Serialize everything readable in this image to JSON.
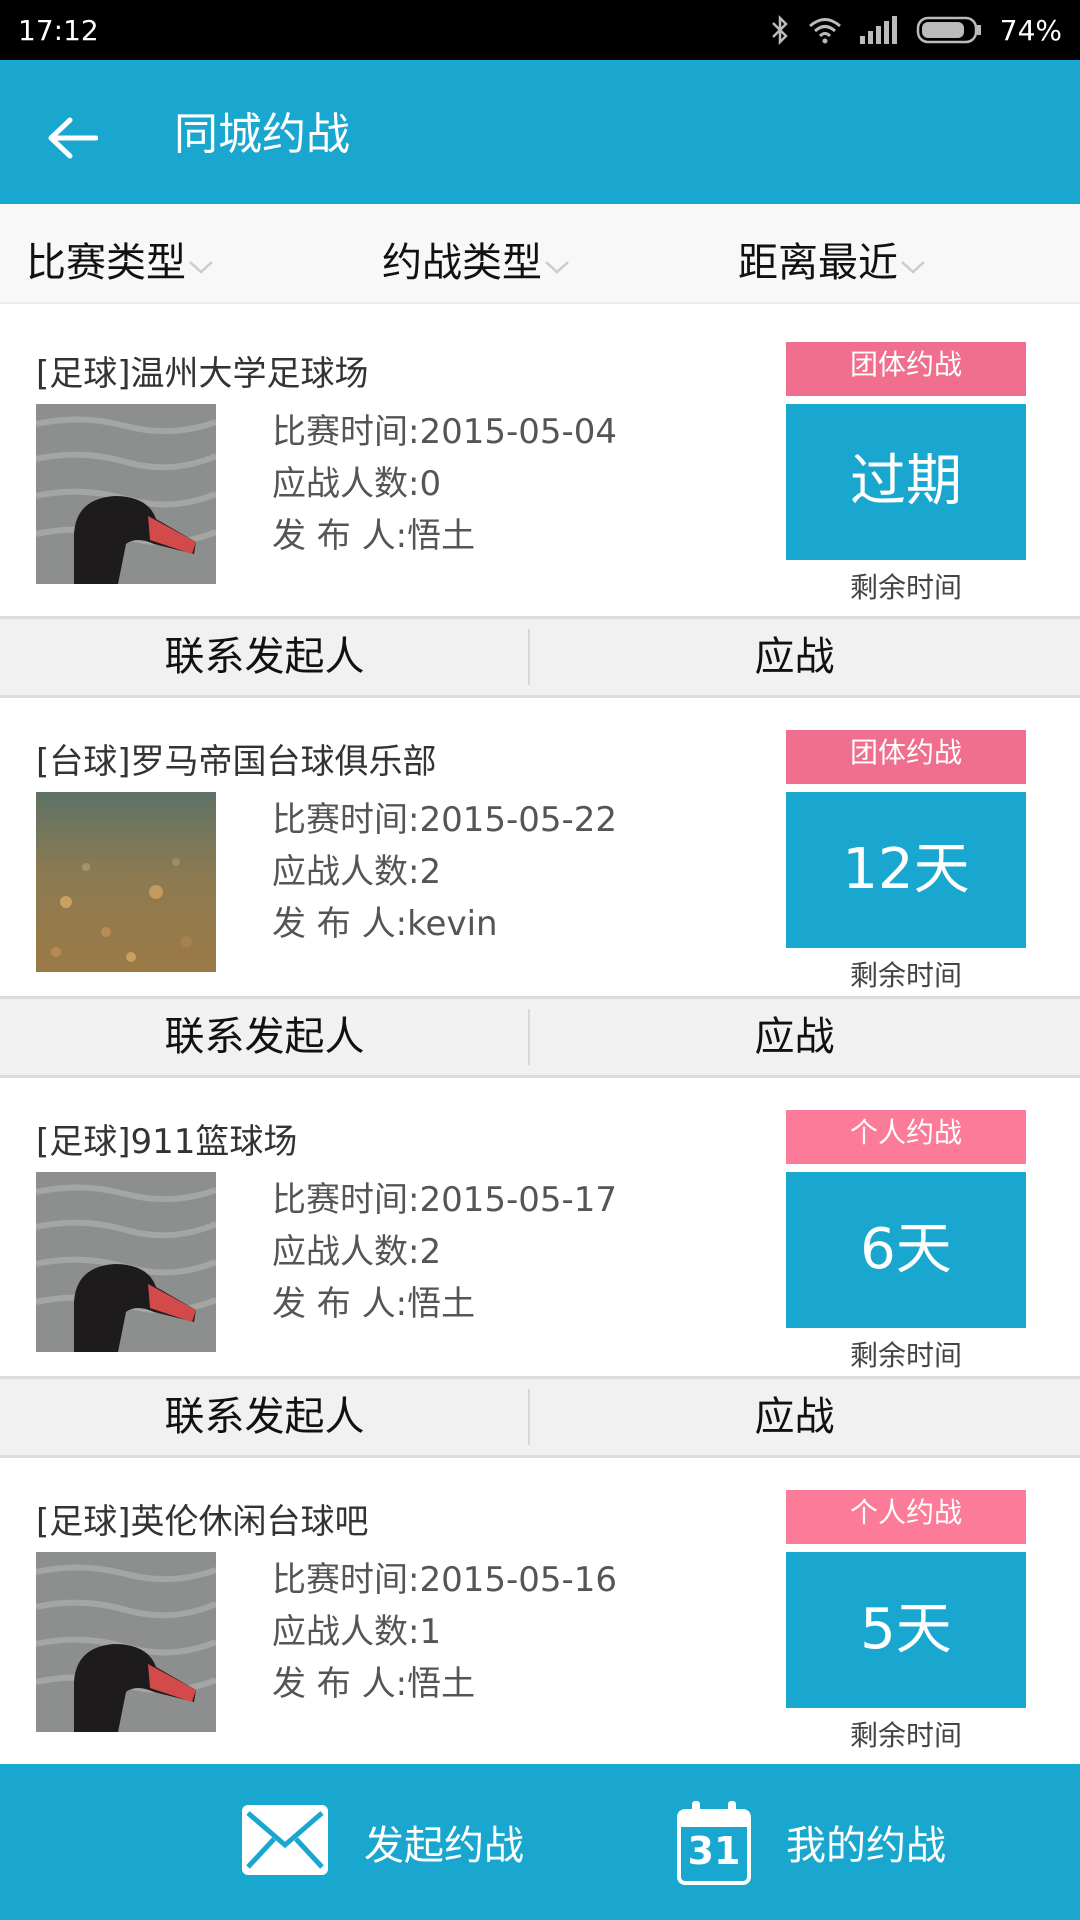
{
  "status_bar": {
    "time": "17:12",
    "battery": "74%",
    "icons": [
      "bluetooth-icon",
      "wifi-icon",
      "signal-icon",
      "battery-icon"
    ]
  },
  "app_bar": {
    "title": "同城约战",
    "back_icon": "back-arrow-icon"
  },
  "filters": [
    {
      "label": "比赛类型"
    },
    {
      "label": "约战类型"
    },
    {
      "label": "距离最近"
    }
  ],
  "cards": [
    {
      "venue": "[足球]温州大学足球场",
      "time": "比赛时间:2015-05-04",
      "count": "应战人数:0",
      "publisher": "发 布 人:悟土",
      "badge": "团体约战",
      "countdown": "过期",
      "remain": "剩余时间",
      "image": "black-swan"
    },
    {
      "venue": "[台球]罗马帝国台球俱乐部",
      "time": "比赛时间:2015-05-22",
      "count": "应战人数:2",
      "publisher": "发 布 人:kevin",
      "badge": "团体约战",
      "countdown": "12天",
      "remain": "剩余时间",
      "image": "rocky-water"
    },
    {
      "venue": "[足球]911篮球场",
      "time": "比赛时间:2015-05-17",
      "count": "应战人数:2",
      "publisher": "发 布 人:悟土",
      "badge": "个人约战",
      "countdown": "6天",
      "remain": "剩余时间",
      "image": "black-swan"
    },
    {
      "venue": "[足球]英伦休闲台球吧",
      "time": "比赛时间:2015-05-16",
      "count": "应战人数:1",
      "publisher": "发 布 人:悟土",
      "badge": "个人约战",
      "countdown": "5天",
      "remain": "剩余时间",
      "image": "black-swan"
    }
  ],
  "actions": {
    "contact": "联系发起人",
    "accept": "应战"
  },
  "bottom_bar": {
    "launch": "发起约战",
    "mine": "我的约战",
    "calendar_day": "31"
  },
  "colors": {
    "primary": "#1aa7cf",
    "team_badge": "#f06f8f",
    "personal_badge": "#fb7b99"
  }
}
